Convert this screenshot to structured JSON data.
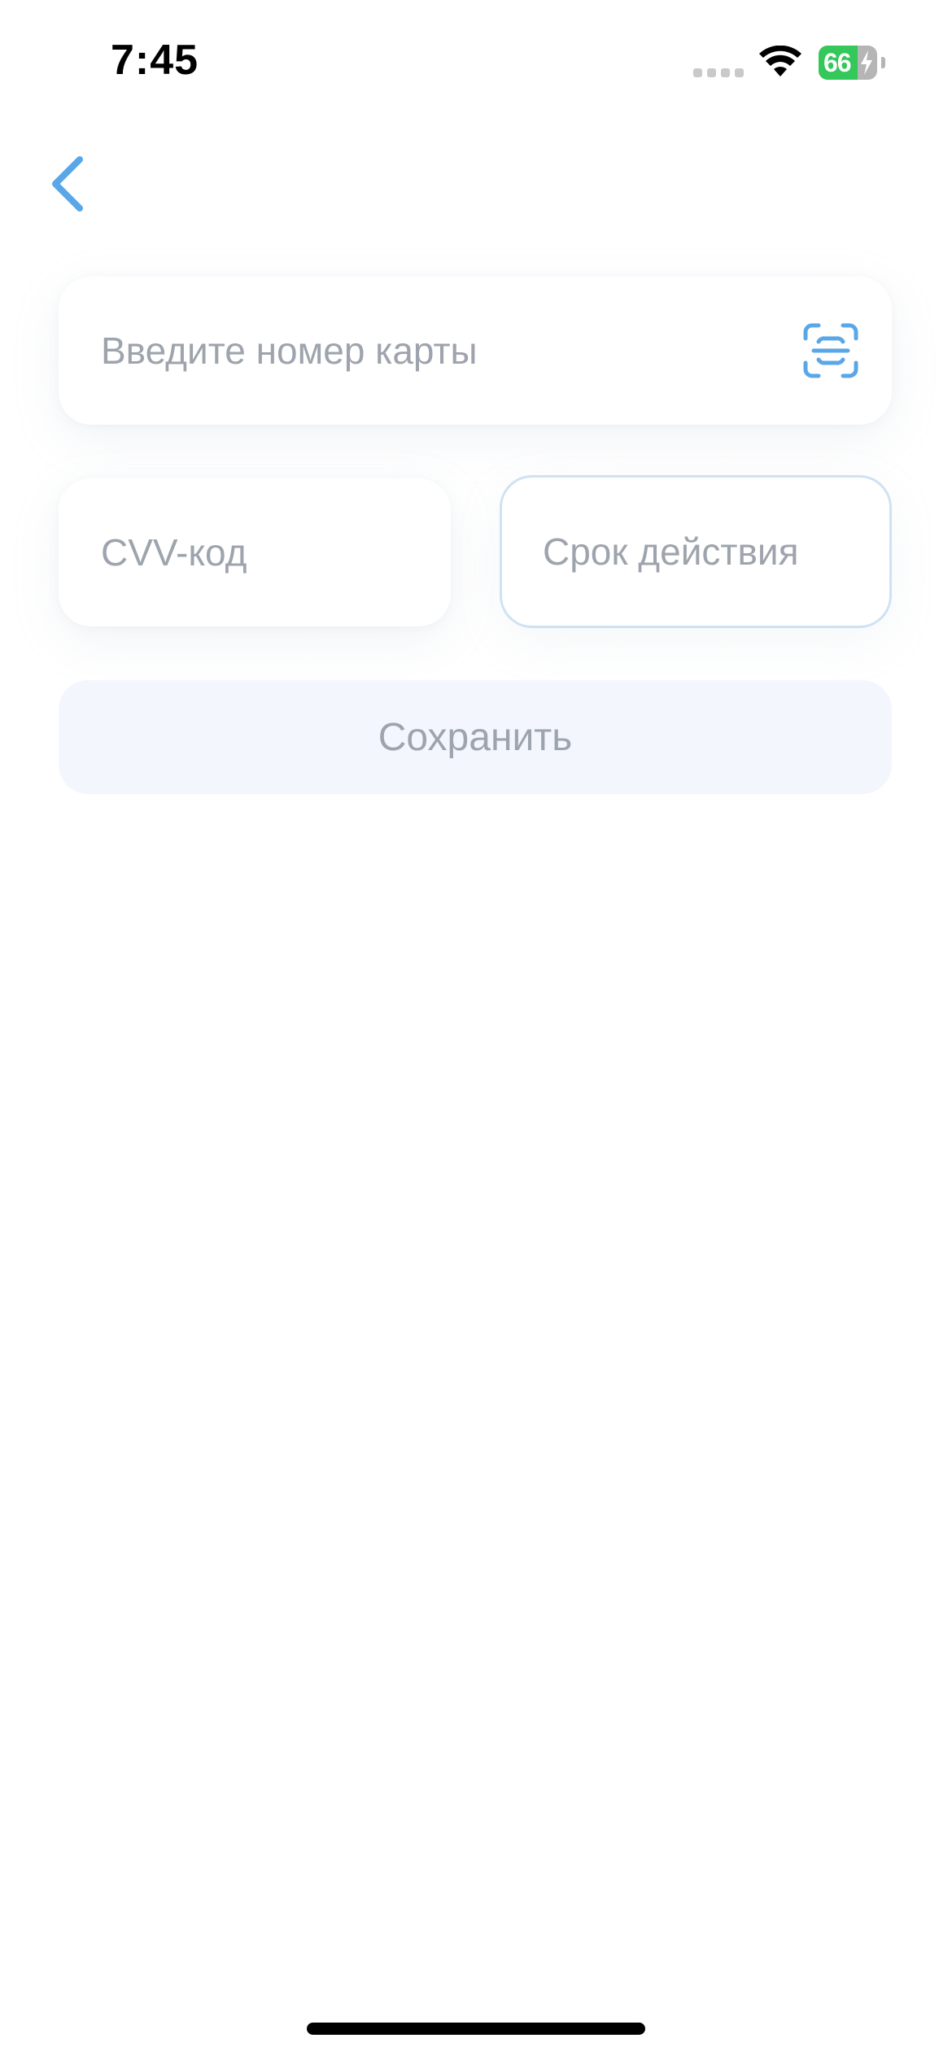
{
  "status_bar": {
    "time": "7:45",
    "battery_level": "66",
    "battery_charging": true,
    "icons": [
      "cellular-signal-icon",
      "wifi-icon",
      "battery-icon",
      "charging-bolt-icon"
    ]
  },
  "navigation": {
    "back_icon": "chevron-left-icon"
  },
  "form": {
    "card_number": {
      "placeholder": "Введите номер карты",
      "value": "",
      "scan_icon": "card-scan-icon"
    },
    "cvv": {
      "placeholder": "CVV-код",
      "value": ""
    },
    "expiry": {
      "placeholder": "Срок действия",
      "value": ""
    },
    "save_label": "Сохранить"
  },
  "colors": {
    "accent": "#5aa7e8",
    "placeholder_text": "#9ea4ad",
    "button_background": "#f3f7fd",
    "focused_border": "#cfe2f3",
    "battery_green": "#34c759"
  }
}
